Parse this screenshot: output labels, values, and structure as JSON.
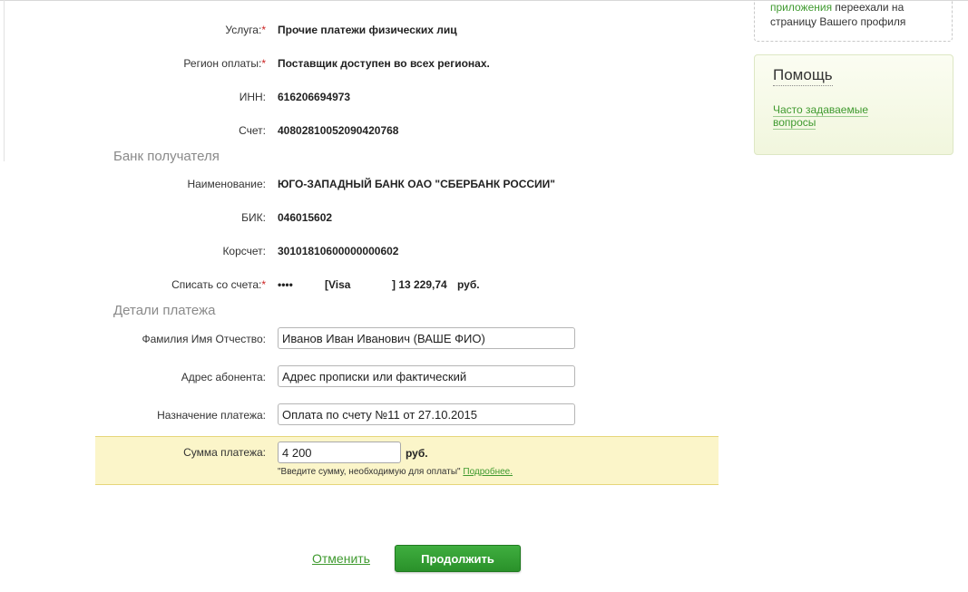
{
  "fields": {
    "service": {
      "label": "Услуга:",
      "value": "Прочие платежи физических лиц"
    },
    "region": {
      "label": "Регион оплаты:",
      "value": "Поставщик доступен во всех регионах."
    },
    "inn": {
      "label": "ИНН:",
      "value": "616206694973"
    },
    "account": {
      "label": "Счет:",
      "value": "40802810052090420768"
    }
  },
  "required_mark": "*",
  "bank_section": {
    "title": "Банк получателя",
    "name": {
      "label": "Наименование:",
      "value": "ЮГО-ЗАПАДНЫЙ БАНК ОАО \"СБЕРБАНК РОССИИ\""
    },
    "bik": {
      "label": "БИК:",
      "value": "046015602"
    },
    "corr": {
      "label": "Корсчет:",
      "value": "30101810600000000602"
    },
    "debit": {
      "label": "Списать со счета:",
      "mask": "••••",
      "card_type": "[Visa",
      "balance": "] 13 229,74",
      "currency": "руб."
    }
  },
  "details_section": {
    "title": "Детали платежа",
    "fio": {
      "label": "Фамилия Имя Отчество:",
      "value": "Иванов Иван Иванович (ВАШЕ ФИО)"
    },
    "address": {
      "label": "Адрес абонента:",
      "value": "Адрес прописки или фактический"
    },
    "purpose": {
      "label": "Назначение платежа:",
      "value": "Оплата по счету №11 от 27.10.2015"
    },
    "amount": {
      "label": "Сумма платежа:",
      "value": "4 200",
      "currency": "руб.",
      "hint": "\"Введите сумму, необходимую для оплаты\"",
      "hint_link": "Подробнее."
    }
  },
  "actions": {
    "cancel": "Отменить",
    "continue": "Продолжить"
  },
  "sidebar": {
    "info_link": "приложения",
    "info_text_1": " переехали на",
    "info_text_2": "страницу Вашего профиля",
    "help_title": "Помощь",
    "faq_line1": "Часто задаваемые",
    "faq_line2": "вопросы"
  },
  "colors": {
    "accent_green": "#3f9a2f",
    "button_green": "#2a912a",
    "highlight_band": "#fbf5c9",
    "required_red": "#cc2222"
  }
}
